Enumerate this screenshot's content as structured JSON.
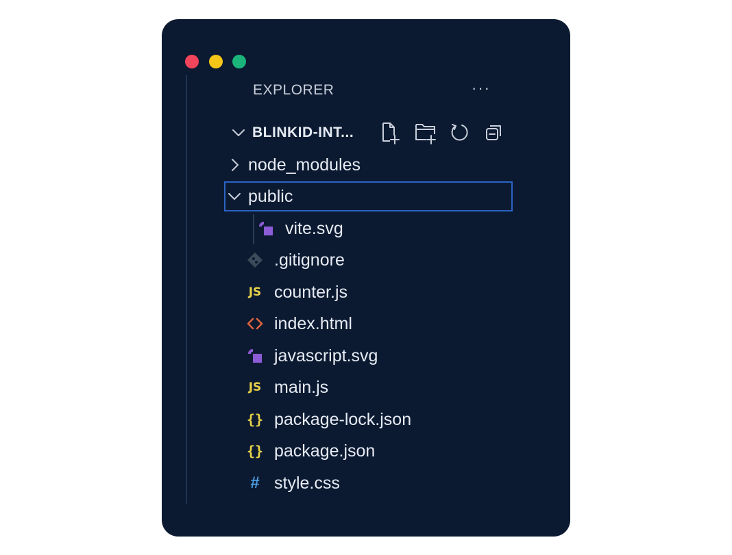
{
  "window": {
    "traffic_lights": [
      {
        "name": "close",
        "color": "#f2445b"
      },
      {
        "name": "minimize",
        "color": "#f5c518"
      },
      {
        "name": "maximize",
        "color": "#1bb57b"
      }
    ]
  },
  "explorer": {
    "title": "EXPLORER",
    "more_label": "···",
    "root": {
      "label": "BLINKID-INT...",
      "expanded": true
    },
    "toolbar": [
      {
        "name": "new-file-icon"
      },
      {
        "name": "new-folder-icon"
      },
      {
        "name": "refresh-icon"
      },
      {
        "name": "collapse-all-icon"
      }
    ]
  },
  "tree": {
    "node_modules": {
      "label": "node_modules"
    },
    "public": {
      "label": "public"
    },
    "vite_svg": {
      "label": "vite.svg"
    },
    "gitignore": {
      "label": ".gitignore"
    },
    "counter_js": {
      "label": "counter.js",
      "icon_text": "JS"
    },
    "index_html": {
      "label": "index.html"
    },
    "javascript_svg": {
      "label": "javascript.svg"
    },
    "main_js": {
      "label": "main.js",
      "icon_text": "JS"
    },
    "package_lock_json": {
      "label": "package-lock.json",
      "icon_text": "{}"
    },
    "package_json": {
      "label": "package.json",
      "icon_text": "{}"
    },
    "style_css": {
      "label": "style.css",
      "icon_text": "#"
    }
  },
  "colors": {
    "background": "#0c1a31",
    "selection_border": "#2a64c4",
    "js": "#e6d24a",
    "json": "#e6d24a",
    "css": "#4c9fe0",
    "html": "#e0643c",
    "svg": "#8c5cd6",
    "git": "#3d4a5a"
  }
}
